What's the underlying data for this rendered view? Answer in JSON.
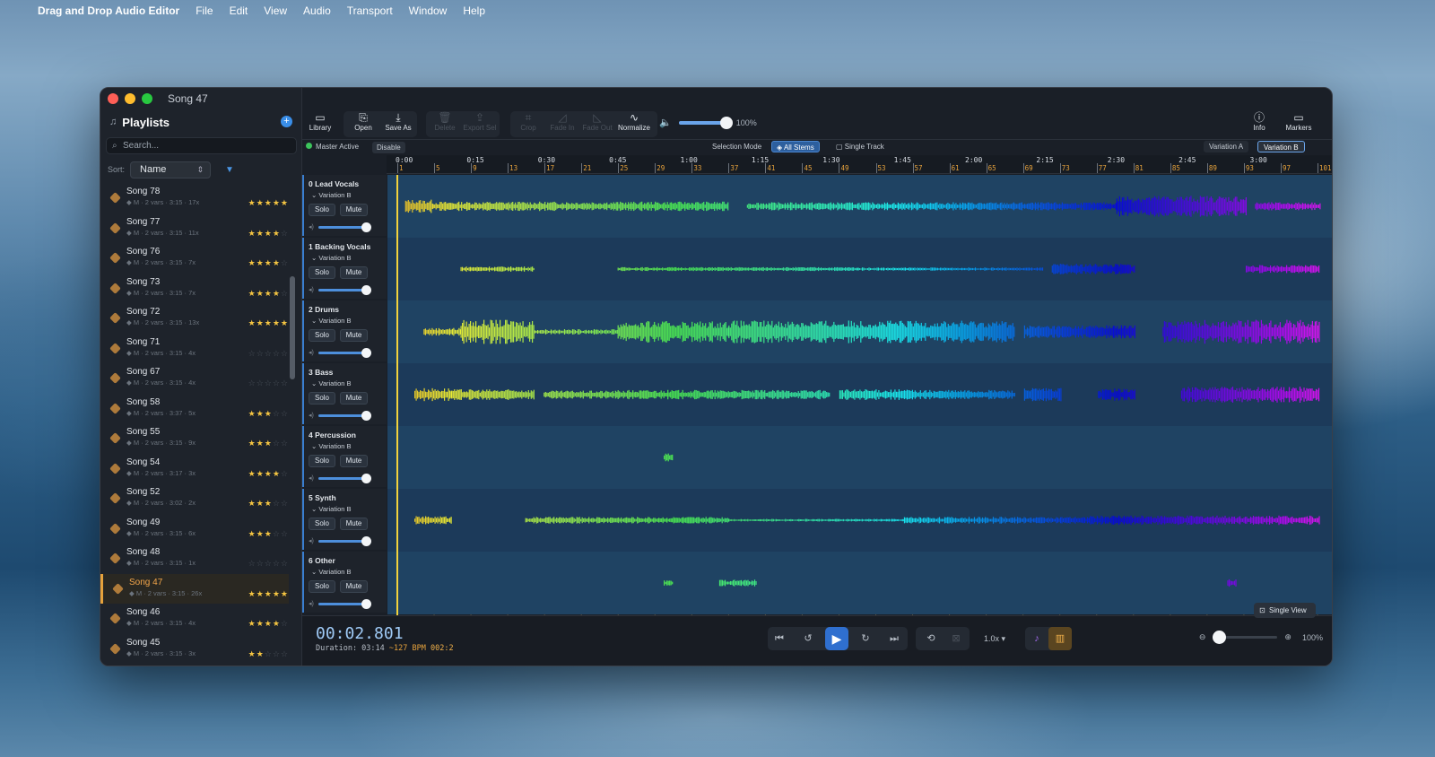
{
  "menubar": {
    "app": "Drag and Drop Audio Editor",
    "items": [
      "File",
      "Edit",
      "View",
      "Audio",
      "Transport",
      "Window",
      "Help"
    ]
  },
  "window": {
    "title": "Song 47"
  },
  "sidebar": {
    "title": "Playlists",
    "search_placeholder": "Search...",
    "sort_label": "Sort:",
    "sort_value": "Name",
    "songs": [
      {
        "name": "Song 78",
        "meta": "◆ M · 2 vars · 3:15 · 17x",
        "stars": 5
      },
      {
        "name": "Song 77",
        "meta": "◆ M · 2 vars · 3:15 · 11x",
        "stars": 4
      },
      {
        "name": "Song 76",
        "meta": "◆ M · 2 vars · 3:15 · 7x",
        "stars": 4
      },
      {
        "name": "Song 73",
        "meta": "◆ M · 2 vars · 3:15 · 7x",
        "stars": 4
      },
      {
        "name": "Song 72",
        "meta": "◆ M · 2 vars · 3:15 · 13x",
        "stars": 5
      },
      {
        "name": "Song 71",
        "meta": "◆ M · 2 vars · 3:15 · 4x",
        "stars": 0
      },
      {
        "name": "Song 67",
        "meta": "◆ M · 2 vars · 3:15 · 4x",
        "stars": 0
      },
      {
        "name": "Song 58",
        "meta": "◆ M · 2 vars · 3:37 · 5x",
        "stars": 3
      },
      {
        "name": "Song 55",
        "meta": "◆ M · 2 vars · 3:15 · 9x",
        "stars": 3
      },
      {
        "name": "Song 54",
        "meta": "◆ M · 2 vars · 3:17 · 3x",
        "stars": 4
      },
      {
        "name": "Song 52",
        "meta": "◆ M · 2 vars · 3:02 · 2x",
        "stars": 3
      },
      {
        "name": "Song 49",
        "meta": "◆ M · 2 vars · 3:15 · 6x",
        "stars": 3
      },
      {
        "name": "Song 48",
        "meta": "◆ M · 2 vars · 3:15 · 1x",
        "stars": 0
      },
      {
        "name": "Song 47",
        "meta": "◆ M · 2 vars · 3:15 · 26x",
        "stars": 5,
        "selected": true
      },
      {
        "name": "Song 46",
        "meta": "◆ M · 2 vars · 3:15 · 4x",
        "stars": 4
      },
      {
        "name": "Song 45",
        "meta": "◆ M · 2 vars · 3:15 · 3x",
        "stars": 2
      }
    ]
  },
  "toolbar": {
    "library": "Library",
    "open": "Open",
    "save_as": "Save As",
    "delete": "Delete",
    "export_sel": "Export Sel",
    "crop": "Crop",
    "fade_in": "Fade In",
    "fade_out": "Fade Out",
    "normalize": "Normalize",
    "volume": "100%",
    "volume_level": 0.95,
    "info": "Info",
    "markers": "Markers"
  },
  "status": {
    "master": "Master Active",
    "disable": "Disable",
    "selection_mode": "Selection Mode",
    "all_stems": "All Stems",
    "single_track": "Single Track",
    "variation_a": "Variation A",
    "variation_b": "Variation B"
  },
  "timeline": {
    "times": [
      "0:00",
      "0:15",
      "0:30",
      "0:45",
      "1:00",
      "1:15",
      "1:30",
      "1:45",
      "2:00",
      "2:15",
      "2:30",
      "2:45",
      "3:00"
    ],
    "bars": [
      "1",
      "5",
      "9",
      "13",
      "17",
      "21",
      "25",
      "29",
      "33",
      "37",
      "41",
      "45",
      "49",
      "53",
      "57",
      "61",
      "65",
      "69",
      "73",
      "77",
      "81",
      "85",
      "89",
      "93",
      "97",
      "101"
    ]
  },
  "tracks": [
    {
      "name": "0 Lead Vocals",
      "variation": "Variation B",
      "solo": "Solo",
      "mute": "Mute"
    },
    {
      "name": "1 Backing Vocals",
      "variation": "Variation B",
      "solo": "Solo",
      "mute": "Mute"
    },
    {
      "name": "2 Drums",
      "variation": "Variation B",
      "solo": "Solo",
      "mute": "Mute"
    },
    {
      "name": "3 Bass",
      "variation": "Variation B",
      "solo": "Solo",
      "mute": "Mute"
    },
    {
      "name": "4 Percussion",
      "variation": "Variation B",
      "solo": "Solo",
      "mute": "Mute"
    },
    {
      "name": "5 Synth",
      "variation": "Variation B",
      "solo": "Solo",
      "mute": "Mute"
    },
    {
      "name": "6 Other",
      "variation": "Variation B",
      "solo": "Solo",
      "mute": "Mute"
    }
  ],
  "single_view": "Single View",
  "transport": {
    "clock": "00:02.801",
    "duration_label": "Duration: 03:14",
    "bpm": "~127 BPM",
    "position": "002:2",
    "speed": "1.0x",
    "zoom": "100%"
  },
  "colors": {
    "accent": "#2f6fcf",
    "playhead": "#f2d23c",
    "bars": "#e6a23c",
    "selected": "#f2a54a"
  }
}
